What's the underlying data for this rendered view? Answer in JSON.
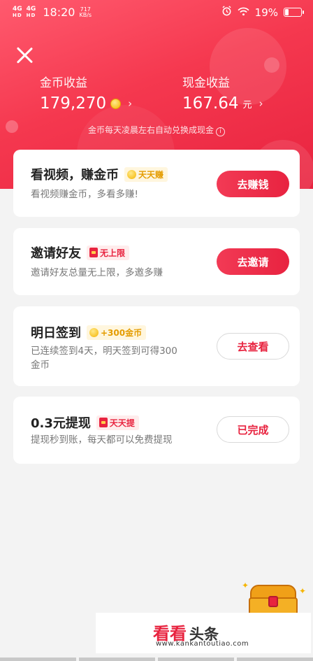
{
  "status_bar": {
    "signal1": "4G",
    "signal1_sub": "HD",
    "signal2": "4G",
    "signal2_sub": "HD",
    "time": "18:20",
    "speed_value": "717",
    "speed_unit": "KB/s",
    "battery": "19%",
    "icons": [
      "alarm-icon",
      "wifi-icon",
      "battery-icon"
    ]
  },
  "header": {
    "coin_label": "金币收益",
    "coin_value": "179,270",
    "cash_label": "现金收益",
    "cash_value": "167.64",
    "cash_unit": "元",
    "notice": "金币每天凌晨左右自动兑换成现金",
    "colors": {
      "gradient_start": "#ff5a6e",
      "gradient_end": "#e8233f"
    }
  },
  "tasks": [
    {
      "title": "看视频，赚金币",
      "tag": "天天赚",
      "tag_style": "coin",
      "desc": "看视频赚金币，多看多赚!",
      "button": "去赚钱",
      "button_style": "solid"
    },
    {
      "title": "邀请好友",
      "tag": "无上限",
      "tag_style": "red",
      "desc": "邀请好友总量无上限，多邀多赚",
      "button": "去邀请",
      "button_style": "solid"
    },
    {
      "title": "明日签到",
      "tag": "+300金币",
      "tag_style": "coin",
      "desc_line1": "已连续签到4天，明天签到可得300",
      "desc_line2": "金币",
      "button": "去查看",
      "button_style": "outline"
    },
    {
      "title": "0.3元提现",
      "tag": "天天提",
      "tag_style": "red",
      "desc": "提现秒到账，每天都可以免费提现",
      "button": "已完成",
      "button_style": "outline"
    }
  ],
  "watermark": {
    "brand_red": "看看",
    "brand_dark": "头条",
    "url": "www.kankantoutiao.com"
  },
  "accent_color": "#e8233f"
}
